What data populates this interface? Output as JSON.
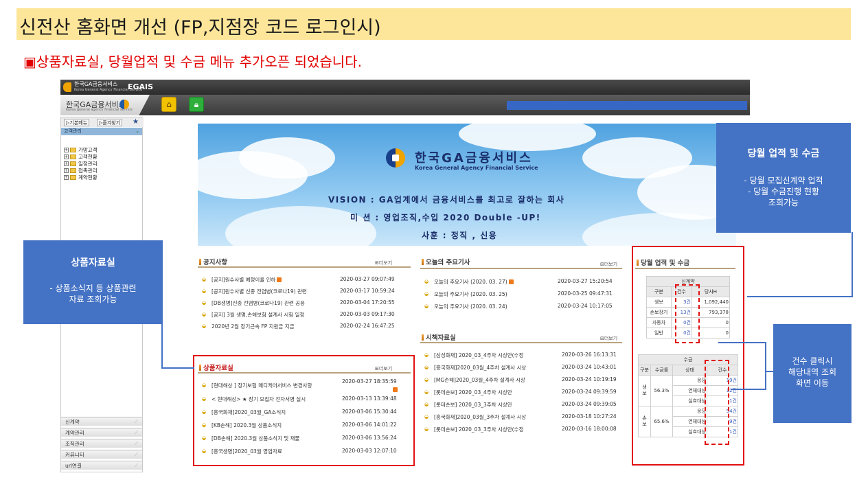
{
  "page": {
    "title": "신전산 홈화면 개선 (FP,지점장 코드 로그인시)",
    "subtitle": "▣상품자료실, 당월업적 및 수금 메뉴 추가오픈 되었습니다."
  },
  "app": {
    "brand_kr": "한국GA금융서비스",
    "brand_en": "Korea General Agency Financial Service",
    "system_name": "EGAIS",
    "nav_logo_kr": "한국GA금융서비스",
    "nav_logo_en": "Korea general agency financial service",
    "home_icon": "home-icon",
    "lock_icon": "lock-icon"
  },
  "sidebar": {
    "tabs": [
      "▷기본메뉴",
      "▷즐겨찾기"
    ],
    "star": "★",
    "header": "고객관리",
    "tree": [
      "가망고객",
      "고객현황",
      "일정관리",
      "접촉관리",
      "계약현황"
    ],
    "bottom_menu": [
      "신계약",
      "계약관리",
      "조직관리",
      "커뮤니티",
      "url연결"
    ]
  },
  "banner": {
    "brand_kr": "한국GA금융서비스",
    "brand_en": "Korea General Agency Financial Service",
    "vision": "VISION : GA업계에서 금융서비스를 최고로 잘하는 회사",
    "mission": "미      션 : 영업조직,수입 2020 Double -UP!",
    "motto": "사훈 : 정직 , 신용"
  },
  "more_label": "⊞더보기",
  "notice": {
    "title": "공지사항",
    "items": [
      {
        "text": "[공지]원수사별 예정이율 인하",
        "date": "2020-03-27 09:07:49",
        "new": true
      },
      {
        "text": "[공지]원수사별 신종 전염병(코로나19) 관련",
        "date": "2020-03-17 10:59:24",
        "new": false
      },
      {
        "text": "[DB생명]신종 전염병(코로나19) 관련 공용",
        "date": "2020-03-04 17:20:55",
        "new": false
      },
      {
        "text": "[공지] 3월 생명,손해보험 설계사 시험 일정",
        "date": "2020-03-03 09:17:30",
        "new": false
      },
      {
        "text": "2020년 2월 장기근속 FP 지원금 지급",
        "date": "2020-02-24 16:47:25",
        "new": false
      }
    ]
  },
  "products": {
    "title": "상품자료실",
    "items": [
      {
        "text": "[현대해상 ] 장기보험 메디케어서비스 변경사항",
        "date": "2020-03-27 18:35:59",
        "new": true
      },
      {
        "text": "< 현대해상> ★ 장기 모집자 전자서명 실시",
        "date": "2020-03-13 13:39:48",
        "new": false
      },
      {
        "text": "[흥국화재]2020_03월_GA소식지",
        "date": "2020-03-06 15:30:44",
        "new": false
      },
      {
        "text": "[KB손해] 2020.3월 상품소식지",
        "date": "2020-03-06 14:01:22",
        "new": false
      },
      {
        "text": "[DB손해] 2020.3월 상품소식지 및 재물",
        "date": "2020-03-06 13:56:24",
        "new": false
      },
      {
        "text": "[흥국생명]2020_03월 영업자료",
        "date": "2020-03-03 12:07:10",
        "new": false
      }
    ]
  },
  "news": {
    "title": "오늘의 주요기사",
    "items": [
      {
        "text": "오늘의 주요기사 (2020. 03. 27)",
        "date": "2020-03-27 15:20:54",
        "new": true
      },
      {
        "text": "오늘의 주요기사 (2020. 03. 25)",
        "date": "2020-03-25 09:47:31",
        "new": false
      },
      {
        "text": "오늘의 주요기사 (2020. 03. 24)",
        "date": "2020-03-24 10:17:05",
        "new": false
      }
    ]
  },
  "market": {
    "title": "시책자료실",
    "items": [
      {
        "text": "[삼성화재] 2020_03_4주차 시상안(수정",
        "date": "2020-03-26 16:13:31"
      },
      {
        "text": "[흥국화재]2020_03월_4주차 설계사 시상",
        "date": "2020-03-24 10:43:01"
      },
      {
        "text": "[MG손해]2020_03월_4주차 설계사 시상",
        "date": "2020-03-24 10:19:19"
      },
      {
        "text": "[롯데손보] 2020_03_4주차 시상안",
        "date": "2020-03-24 09:39:59"
      },
      {
        "text": "[롯데손보] 2020_03_3주차 시상안",
        "date": "2020-03-24 09:39:05"
      },
      {
        "text": "[흥국화재]2020_03월_3주차 설계사 시상",
        "date": "2020-03-18 10:27:24"
      },
      {
        "text": "[롯데손보] 2020_03_3주차 시상안(수정",
        "date": "2020-03-16 18:00:08"
      }
    ]
  },
  "results": {
    "title": "당월 업적 및 수금",
    "new_contract": {
      "group_label": "신계약",
      "headers": [
        "구분",
        "건수",
        "당사H"
      ],
      "rows": [
        {
          "label": "생보",
          "count": "3건",
          "amount": "1,092,440"
        },
        {
          "label": "손보장기",
          "count": "13건",
          "amount": "793,378"
        },
        {
          "label": "자동차",
          "count": "0건",
          "amount": "0"
        },
        {
          "label": "일반",
          "count": "0건",
          "amount": "0"
        }
      ]
    },
    "collection": {
      "group_label": "수금",
      "headers": [
        "구분",
        "수금률",
        "상태",
        "건수"
      ],
      "groups": [
        {
          "label": "생\n보",
          "rate": "56.3%",
          "rows": [
            {
              "status": "응당",
              "count": "19건"
            },
            {
              "status": "연체대상",
              "count": "12건"
            },
            {
              "status": "실효대상",
              "count": "1건"
            }
          ]
        },
        {
          "label": "손\n보",
          "rate": "65.6%",
          "rows": [
            {
              "status": "응당",
              "count": "54건"
            },
            {
              "status": "연체대상",
              "count": "9건"
            },
            {
              "status": "실효대상",
              "count": "1건"
            }
          ]
        }
      ]
    }
  },
  "callouts": {
    "product": {
      "title": "상품자료실",
      "body": "- 상품소식지 등 상품관련\n자료 조회가능"
    },
    "results": {
      "title": "당월 업적 및 수금",
      "body": "-  당월 모집신계약 업적\n-  당월 수금진행 현황\n조회가능"
    },
    "click": {
      "body": "건수 클릭시\n해당내역 조회\n화면 이동"
    }
  },
  "colors": {
    "title_bg": "#fde69a",
    "accent_red": "#e10000",
    "callout_blue": "#4472c4",
    "link_blue": "#3a5ab8"
  }
}
